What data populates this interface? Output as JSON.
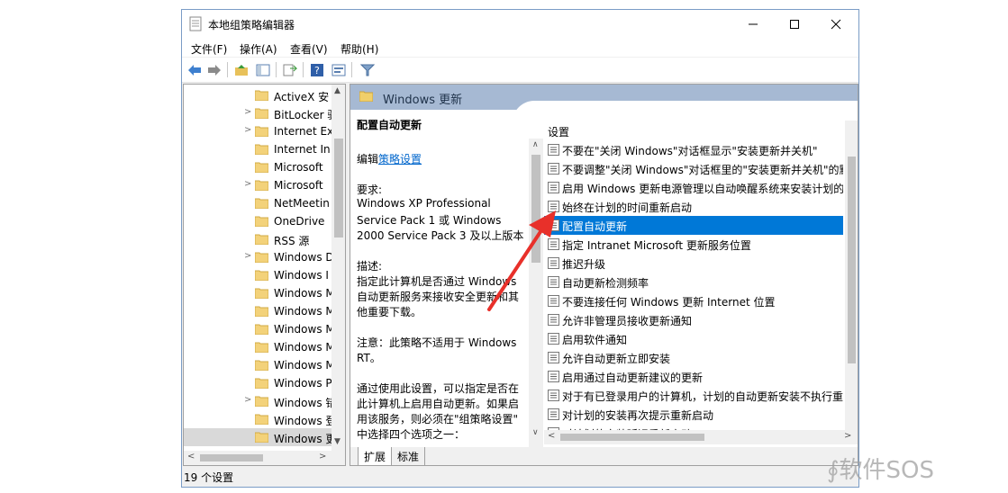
{
  "window": {
    "title": "本地组策略编辑器",
    "controls": {
      "minimize": "—",
      "maximize": "☐",
      "close": "✕"
    }
  },
  "menu": [
    "文件(F)",
    "操作(A)",
    "查看(V)",
    "帮助(H)"
  ],
  "toolbar": [
    "back-icon",
    "forward-icon",
    "up-folder-icon",
    "show-hide-tree-icon",
    "export-list-icon",
    "help-icon",
    "properties-icon",
    "filter-icon"
  ],
  "tree": {
    "items": [
      {
        "label": "ActiveX 安",
        "arrow": ""
      },
      {
        "label": "BitLocker 驱",
        "arrow": ">"
      },
      {
        "label": "Internet Ex",
        "arrow": ">"
      },
      {
        "label": "Internet In",
        "arrow": ""
      },
      {
        "label": "Microsoft",
        "arrow": ""
      },
      {
        "label": "Microsoft",
        "arrow": ">"
      },
      {
        "label": "NetMeetin",
        "arrow": ""
      },
      {
        "label": "OneDrive",
        "arrow": ""
      },
      {
        "label": "RSS 源",
        "arrow": ""
      },
      {
        "label": "Windows D",
        "arrow": ">"
      },
      {
        "label": "Windows I",
        "arrow": ""
      },
      {
        "label": "Windows M",
        "arrow": ""
      },
      {
        "label": "Windows M",
        "arrow": ""
      },
      {
        "label": "Windows M",
        "arrow": ""
      },
      {
        "label": "Windows M",
        "arrow": ""
      },
      {
        "label": "Windows M",
        "arrow": ""
      },
      {
        "label": "Windows P",
        "arrow": ""
      },
      {
        "label": "Windows 错",
        "arrow": ">"
      },
      {
        "label": "Windows 登",
        "arrow": ""
      },
      {
        "label": "Windows 更",
        "arrow": "",
        "selected": true
      }
    ],
    "scroll_up": "▲",
    "scroll_down": "▼",
    "scroll_left": "<",
    "scroll_right": ">"
  },
  "header": {
    "title": "Windows 更新"
  },
  "description": {
    "title": "配置自动更新",
    "edit_prefix": "编辑",
    "edit_link": "策略设置",
    "requirements_label": "要求:",
    "requirements": [
      "Windows XP Professional",
      "Service Pack 1 或 Windows",
      "2000 Service Pack 3 及以上版本"
    ],
    "desc_label": "描述:",
    "desc_lines": [
      "指定此计算机是否通过 Windows",
      "自动更新服务来接收安全更新和其",
      "他重要下载。"
    ],
    "note_lines": [
      "注意：此策略不适用于 Windows",
      "RT。"
    ],
    "more_lines": [
      "通过使用此设置，可以指定是否在",
      "此计算机上启用自动更新。如果启",
      "用该服务，则必须在\"组策略设置\"",
      "中选择四个选项之一："
    ]
  },
  "settings": {
    "column_header": "设置",
    "rows": [
      "不要在\"关闭 Windows\"对话框显示\"安装更新并关机\"",
      "不要调整\"关闭 Windows\"对话框里的\"安装更新并关机\"的默",
      "启用 Windows 更新电源管理以自动唤醒系统来安装计划的",
      "始终在计划的时间重新启动",
      "配置自动更新",
      "指定 Intranet Microsoft 更新服务位置",
      "推迟升级",
      "自动更新检测频率",
      "不要连接任何 Windows 更新 Internet 位置",
      "允许非管理员接收更新通知",
      "启用软件通知",
      "允许自动更新立即安装",
      "启用通过自动更新建议的更新",
      "对于有已登录用户的计算机，计划的自动更新安装不执行重",
      "对计划的安装再次提示重新启动",
      "对计划的安装延迟重新启动"
    ],
    "selected_index": 4
  },
  "tabs": [
    "扩展",
    "标准"
  ],
  "status": "19 个设置",
  "watermark": "软件SOS",
  "colors": {
    "selection": "#0078d7",
    "header": "#a6b9d3",
    "arrow": "#e8302a"
  }
}
